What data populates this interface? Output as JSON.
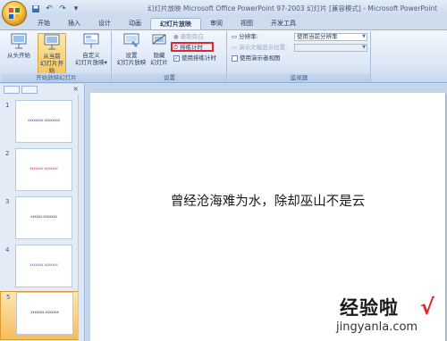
{
  "window": {
    "title": "幻灯片放映 Microsoft Office PowerPoint 97-2003 幻灯片 [兼容模式] - Microsoft PowerPoint",
    "quick_access": [
      "save-icon",
      "undo-icon",
      "redo-icon",
      "more-icon"
    ]
  },
  "tabs": [
    {
      "label": "开始"
    },
    {
      "label": "插入"
    },
    {
      "label": "设计"
    },
    {
      "label": "动画"
    },
    {
      "label": "幻灯片放映"
    },
    {
      "label": "审阅"
    },
    {
      "label": "视图"
    },
    {
      "label": "开发工具"
    }
  ],
  "ribbon": {
    "groups": {
      "start_show": {
        "label": "开始放映幻灯片",
        "from_beginning": "从头开始",
        "from_current_1": "从当前",
        "from_current_2": "幻灯片开始",
        "custom_1": "自定义",
        "custom_2": "幻灯片放映▾"
      },
      "setup": {
        "label": "设置",
        "setup_show_1": "设置",
        "setup_show_2": "幻灯片放映",
        "hide_1": "隐藏",
        "hide_2": "幻灯片",
        "record_narration": "录制旁白",
        "rehearse_timings": "排练计时",
        "use_rehearsed": "使用排练计时"
      },
      "monitors": {
        "label": "监视器",
        "resolution_label": "分辨率:",
        "resolution_value": "使用当前分辨率",
        "show_on_label": "演示文稿显示位置:",
        "show_on_value": "",
        "presenter_view": "使用演示者视图"
      }
    }
  },
  "slides_panel": {
    "slides": [
      {
        "num": "1",
        "text": "XXXXXXXX XXXXXXXX",
        "color": "#1b2f8f"
      },
      {
        "num": "2",
        "text": "XXXXXXX XXXXXXX",
        "color": "#d01f1f"
      },
      {
        "num": "3",
        "text": "XXXXXX XXXXXXX",
        "color": "#1b1b1b"
      },
      {
        "num": "4",
        "text": "XXXXXXX XXXXXXX",
        "color": "#7a2fb0"
      },
      {
        "num": "5",
        "text": "XXXXXXX XXXXXXX",
        "color": "#1b1b1b"
      }
    ],
    "selected_index": 4
  },
  "slide": {
    "main_text": "曾经沧海难为水，除却巫山不是云"
  },
  "watermark": {
    "cn": "经验啦",
    "check": "√",
    "url": "jingyanla.com"
  },
  "colors": {
    "highlight_red": "#e0262a",
    "selected_slide": "#f5bd5b"
  }
}
